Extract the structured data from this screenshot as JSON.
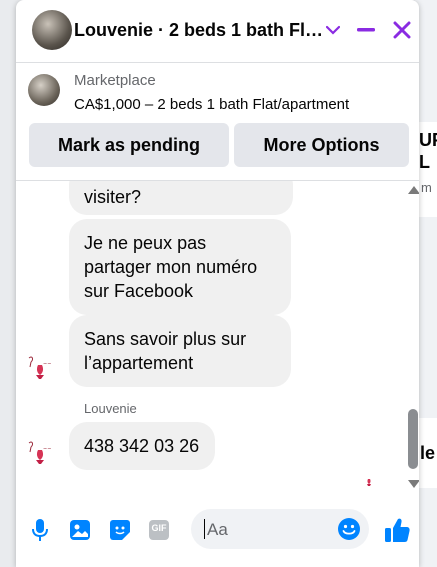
{
  "header": {
    "title": "Louvenie · 2 beds 1 bath Fl…"
  },
  "marketplace": {
    "label": "Marketplace",
    "listing": "CA$1,000 – 2 beds 1 bath Flat/apartment",
    "mark_pending": "Mark as pending",
    "more_options": "More Options"
  },
  "messages": [
    {
      "text": "visiter?"
    },
    {
      "text": "Je ne peux  pas partager mon numéro sur Facebook"
    },
    {
      "text": "Sans savoir plus sur l’appartement"
    },
    {
      "text": "438 342 03 26"
    }
  ],
  "sender_name": "Louvenie",
  "composer": {
    "placeholder": "Aa",
    "gif_label": "GIF"
  },
  "background_page": {
    "line1": "UP",
    "line2": "L",
    "line3": "m",
    "line4": "le"
  },
  "colors": {
    "accent": "#8a2be2",
    "messenger_blue": "#0084ff",
    "bubble_gray": "#f0f0f0"
  }
}
